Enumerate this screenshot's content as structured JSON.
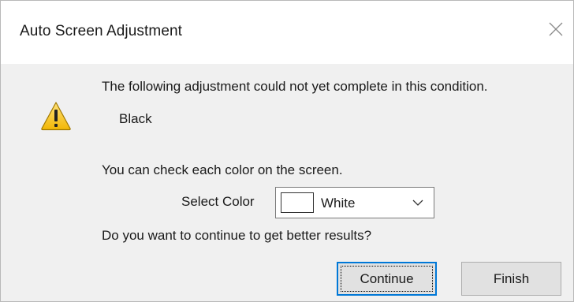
{
  "window": {
    "title": "Auto Screen Adjustment",
    "close_icon": "close-icon"
  },
  "content": {
    "warning_icon": "warning-icon",
    "message_line1": "The following adjustment could not yet complete in this condition.",
    "failed_item": "Black",
    "message_line2": "You can check each color on the screen.",
    "select_label": "Select Color",
    "select": {
      "value": "White",
      "swatch_color": "#ffffff"
    },
    "message_line3": "Do you want to continue to get better results?"
  },
  "buttons": {
    "continue_label": "Continue",
    "finish_label": "Finish"
  },
  "colors": {
    "focus_accent": "#0078d7",
    "warning_fill": "#f4c430"
  }
}
